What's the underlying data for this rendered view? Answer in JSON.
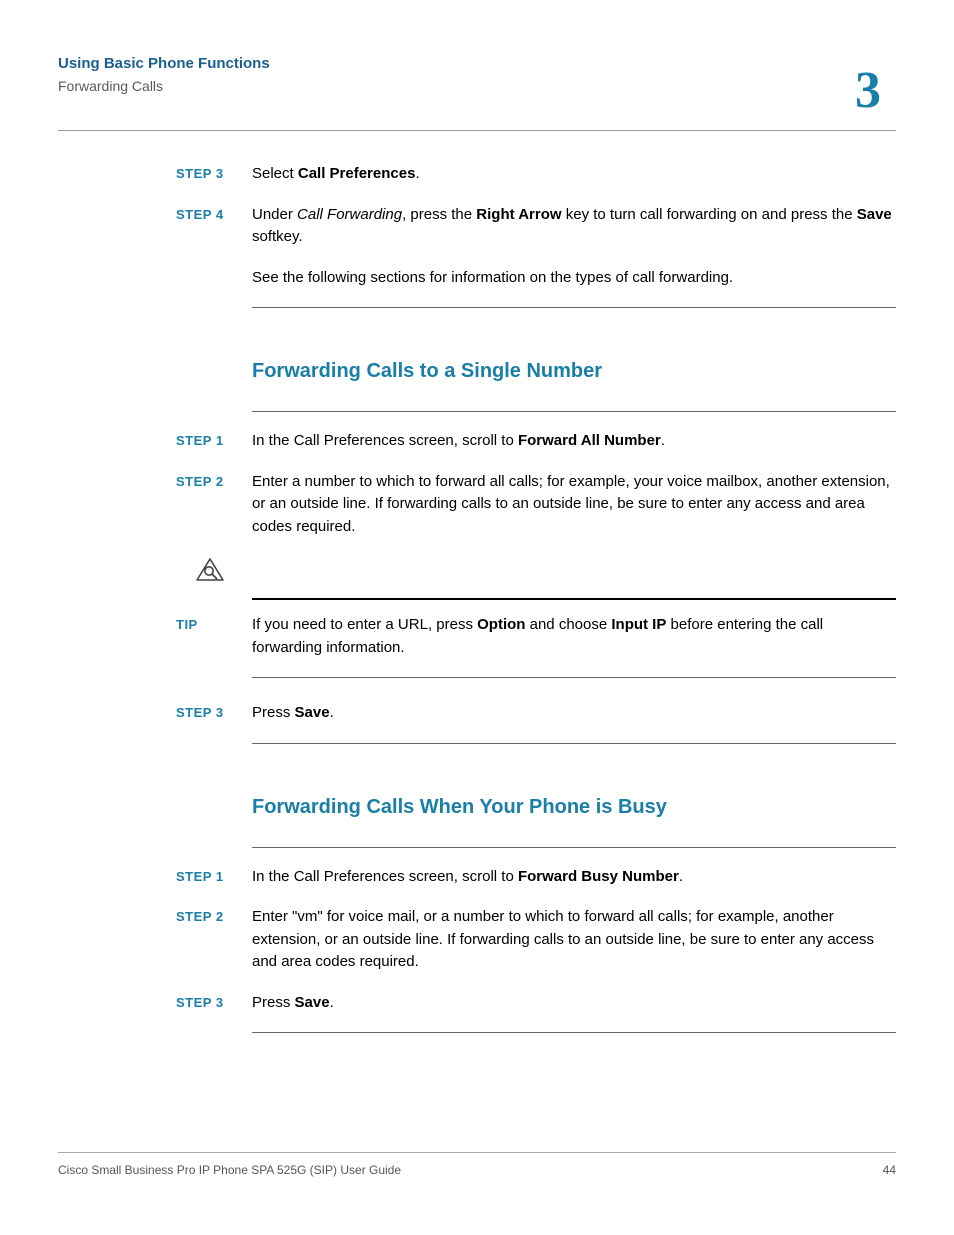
{
  "header": {
    "chapter_title": "Using Basic Phone Functions",
    "breadcrumb": "Forwarding Calls",
    "chapter_number": "3"
  },
  "intro_steps": {
    "step3": {
      "label": "STEP 3",
      "prefix": "Select ",
      "bold1": "Call Preferences",
      "suffix": "."
    },
    "step4": {
      "label": "STEP 4",
      "t1": "Under ",
      "it1": "Call Forwarding",
      "t2": ", press the ",
      "b1": "Right Arrow",
      "t3": " key to turn call forwarding on and press the ",
      "b2": "Save",
      "t4": " softkey.",
      "para2": "See the following sections for information on the types of call forwarding."
    }
  },
  "section1": {
    "heading": "Forwarding Calls to a Single Number",
    "step1": {
      "label": "STEP 1",
      "t1": "In the Call Preferences screen, scroll to ",
      "b1": "Forward All Number",
      "t2": "."
    },
    "step2": {
      "label": "STEP 2",
      "text": "Enter a number to which to forward all calls; for example, your voice mailbox, another extension, or an outside line. If forwarding calls to an outside line, be sure to enter any access and area codes required."
    },
    "tip": {
      "label": "TIP",
      "t1": "If you need to enter a URL, press ",
      "b1": "Option",
      "t2": " and choose ",
      "b2": "Input IP",
      "t3": " before entering the call forwarding information."
    },
    "step3": {
      "label": "STEP 3",
      "t1": "Press ",
      "b1": "Save",
      "t2": "."
    }
  },
  "section2": {
    "heading": "Forwarding Calls When Your Phone is Busy",
    "step1": {
      "label": "STEP 1",
      "t1": "In the Call Preferences screen, scroll to ",
      "b1": "Forward Busy Number",
      "t2": "."
    },
    "step2": {
      "label": "STEP 2",
      "text": "Enter \"vm\" for voice mail, or a number to which to forward all calls; for example, another extension, or an outside line. If forwarding calls to an outside line, be sure to enter any access and area codes required."
    },
    "step3": {
      "label": "STEP 3",
      "t1": "Press ",
      "b1": "Save",
      "t2": "."
    }
  },
  "footer": {
    "left": "Cisco Small Business Pro IP Phone SPA 525G (SIP) User Guide",
    "right": "44"
  }
}
